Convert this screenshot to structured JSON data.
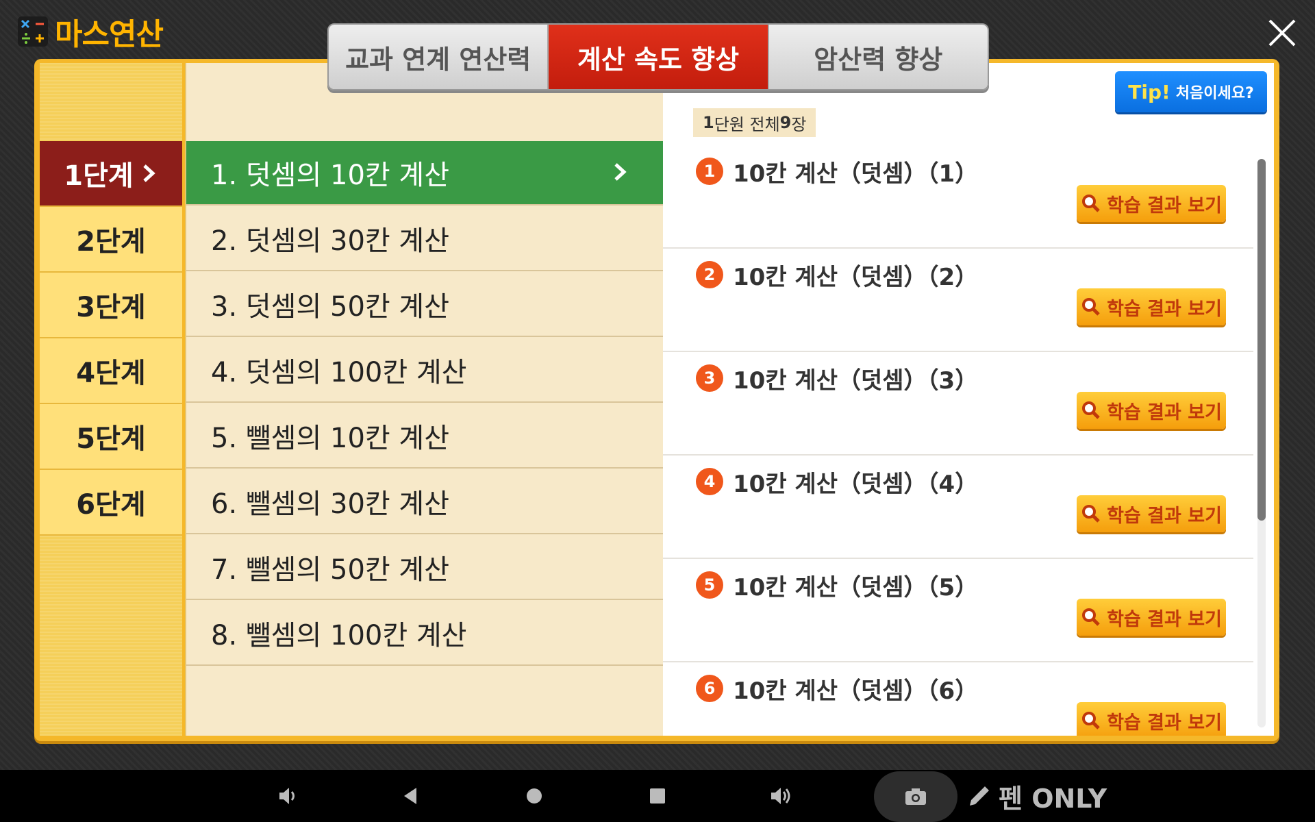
{
  "app": {
    "title": "마스연산"
  },
  "tabs": [
    {
      "label": "교과 연계 연산력",
      "active": false
    },
    {
      "label": "계산 속도 향상",
      "active": true
    },
    {
      "label": "암산력 향상",
      "active": false
    }
  ],
  "levels": [
    {
      "label": "1단계",
      "active": true
    },
    {
      "label": "2단계"
    },
    {
      "label": "3단계"
    },
    {
      "label": "4단계"
    },
    {
      "label": "5단계"
    },
    {
      "label": "6단계"
    }
  ],
  "lessons": [
    {
      "label": "1. 덧셈의 10칸 계산",
      "active": true
    },
    {
      "label": "2. 덧셈의 30칸 계산"
    },
    {
      "label": "3. 덧셈의 50칸 계산"
    },
    {
      "label": "4. 덧셈의 100칸 계산"
    },
    {
      "label": "5. 뺄셈의 10칸 계산"
    },
    {
      "label": "6. 뺄셈의 30칸 계산"
    },
    {
      "label": "7. 뺄셈의 50칸 계산"
    },
    {
      "label": "8. 뺄셈의 100칸 계산"
    }
  ],
  "summary": {
    "unit": "1",
    "unit_suffix": "단원 전체 ",
    "count": "9",
    "count_suffix": "장"
  },
  "tip": {
    "tip_label": "Tip!",
    "text": "처음이세요?"
  },
  "units": [
    {
      "num": "1",
      "title": "10칸 계산（덧셈）（1）",
      "button": "학습 결과 보기"
    },
    {
      "num": "2",
      "title": "10칸 계산（덧셈）（2）",
      "button": "학습 결과 보기"
    },
    {
      "num": "3",
      "title": "10칸 계산（덧셈）（3）",
      "button": "학습 결과 보기"
    },
    {
      "num": "4",
      "title": "10칸 계산（덧셈）（4）",
      "button": "학습 결과 보기"
    },
    {
      "num": "5",
      "title": "10칸 계산（덧셈）（5）",
      "button": "학습 결과 보기"
    },
    {
      "num": "6",
      "title": "10칸 계산（덧셈）（6）",
      "button": "학습 결과 보기"
    }
  ],
  "navbar": {
    "pen_label": "펜 ONLY"
  },
  "colors": {
    "accent_red": "#c31d0d",
    "active_green": "#3a9a45",
    "level_active": "#8c1e1a",
    "panel_yellow": "#f5b82a"
  }
}
